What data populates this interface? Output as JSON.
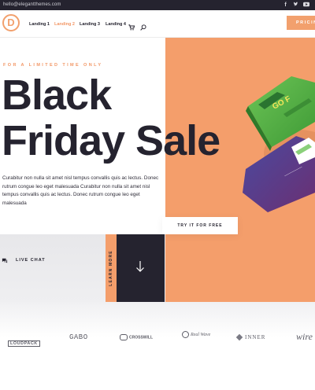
{
  "topbar": {
    "email": "hello@elegantthemes.com",
    "social": [
      "facebook-icon",
      "twitter-icon",
      "youtube-icon"
    ]
  },
  "header": {
    "logo_letter": "D",
    "nav": [
      {
        "label": "Landing 1",
        "active": false
      },
      {
        "label": "Landing 2",
        "active": true
      },
      {
        "label": "Landing 3",
        "active": false
      },
      {
        "label": "Landing 4",
        "active": false
      }
    ],
    "cart_icon": "cart-icon",
    "search_icon": "search-icon",
    "pricing_label": "PRICIN"
  },
  "hero": {
    "kicker": "FOR A LIMITED TIME ONLY",
    "headline_line1": "Black",
    "headline_line2": "Friday Sale",
    "body": "Curabitur non nulla sit amet nisl tempus convallis quis ac lectus. Donec rutrum congue leo eget malesuada Curabitur non nulla sit amet nisl tempus convallis quis ac lectus. Donec rutrum congue leo eget malesuada",
    "cta_label": "TRY IT FOR FREE",
    "live_chat_label": "LIVE CHAT",
    "learn_more_label": "LEARN MORE"
  },
  "partners": [
    "LOUDPACK",
    "GABO",
    "CROSSWILL",
    "Real Wave",
    "INNER",
    "wire"
  ],
  "colors": {
    "accent": "#f49e6b",
    "dark": "#25232f",
    "mockup_green": "#5fb94a",
    "mockup_blue": "#3a3c8f"
  }
}
